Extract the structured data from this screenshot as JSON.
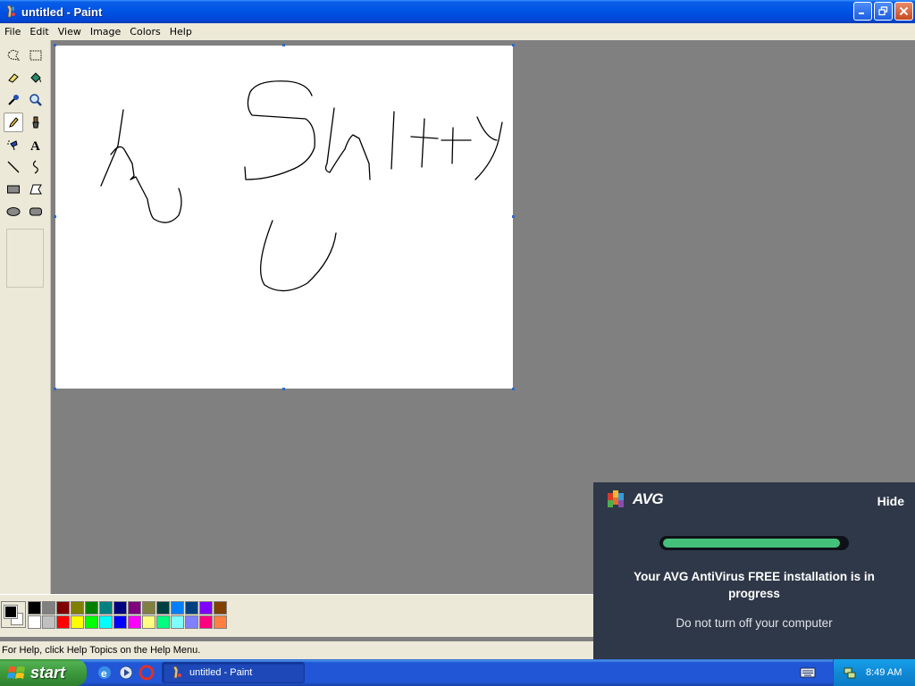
{
  "window": {
    "title": "untitled - Paint"
  },
  "menu": [
    "File",
    "Edit",
    "View",
    "Image",
    "Colors",
    "Help"
  ],
  "tools": [
    "free-form-select",
    "select",
    "eraser",
    "fill-with-color",
    "pick-color",
    "magnifier",
    "pencil",
    "brush",
    "airbrush",
    "text",
    "line",
    "curve",
    "rectangle",
    "polygon",
    "ellipse",
    "rounded-rectangle"
  ],
  "active_tool": "pencil",
  "palette": {
    "foreground": "#000000",
    "background": "#ffffff",
    "row1": [
      "#000000",
      "#808080",
      "#800000",
      "#808000",
      "#008000",
      "#008080",
      "#000080",
      "#800080",
      "#808040",
      "#004040",
      "#0080ff",
      "#004080",
      "#8000ff",
      "#804000"
    ],
    "row2": [
      "#ffffff",
      "#c0c0c0",
      "#ff0000",
      "#ffff00",
      "#00ff00",
      "#00ffff",
      "#0000ff",
      "#ff00ff",
      "#ffff80",
      "#00ff80",
      "#80ffff",
      "#8080ff",
      "#ff0080",
      "#ff8040"
    ]
  },
  "status": {
    "text": "For Help, click Help Topics on the Help Menu."
  },
  "avg": {
    "brand": "AVG",
    "hide_label": "Hide",
    "progress": 0.97,
    "message": "Your AVG AntiVirus FREE installation is in progress",
    "submessage": "Do not turn off your computer"
  },
  "taskbar": {
    "start_label": "start",
    "task_label": "untitled - Paint",
    "clock": "8:49 AM"
  }
}
